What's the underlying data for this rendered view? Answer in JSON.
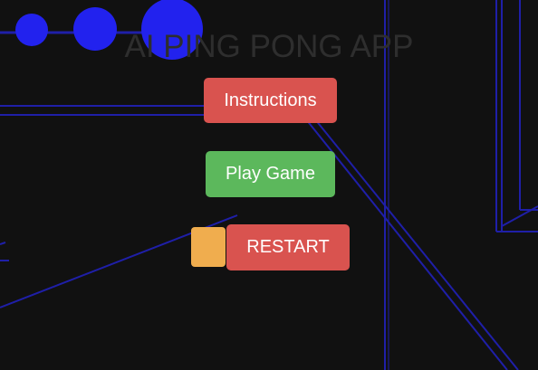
{
  "app": {
    "title": "AI PING PONG APP"
  },
  "buttons": {
    "instructions_label": "Instructions",
    "play_label": "Play Game",
    "restart_label": "RESTART"
  },
  "colors": {
    "background": "#111111",
    "title_text": "#2e2e2e",
    "instructions_button": "#d9534f",
    "play_button": "#5cb85c",
    "restart_button": "#d9534f",
    "side_square": "#f0ad4e",
    "line_color": "#1f1fa8",
    "ball_color": "#2222ee"
  }
}
